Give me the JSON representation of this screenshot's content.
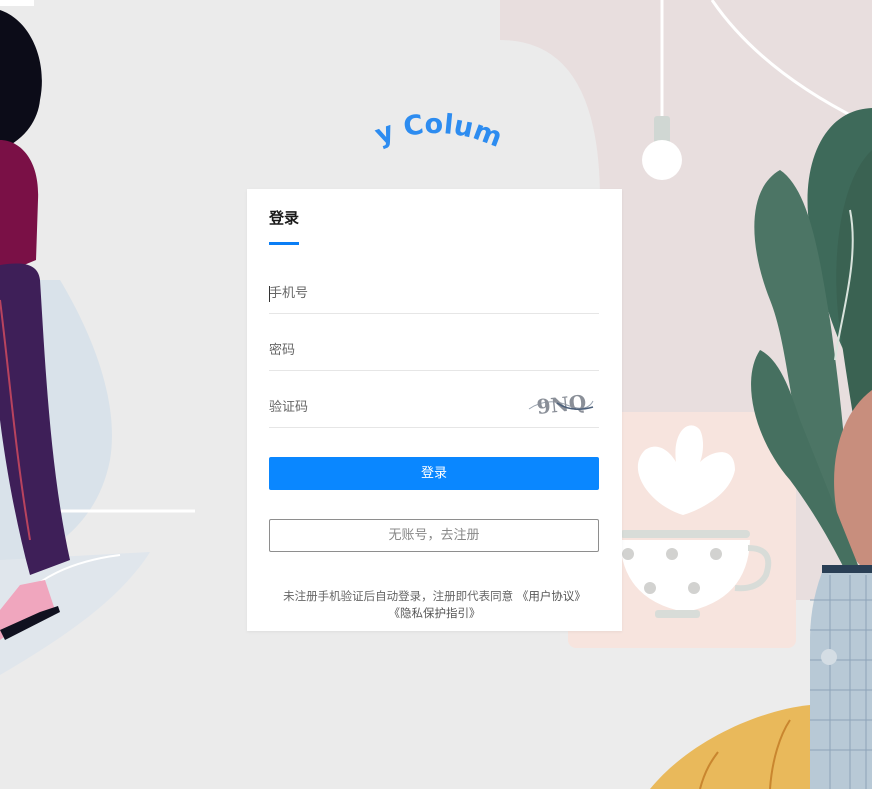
{
  "logo": {
    "text": "My Column"
  },
  "login_card": {
    "tab_label": "登录",
    "phone_placeholder": "手机号",
    "password_placeholder": "密码",
    "code_placeholder": "验证码",
    "captcha_text": "9NQ",
    "login_button": "登录",
    "register_button": "无账号，去注册",
    "agreement": {
      "prefix": "未注册手机验证后自动登录，注册即代表同意",
      "user_agreement": "《用户协议》",
      "privacy_guide": "《隐私保护指引》"
    }
  },
  "colors": {
    "primary": "#0a87ff",
    "tab_underline": "#0a7ef5",
    "logo": "#2d8cf0",
    "page_background": "#ebebeb"
  }
}
